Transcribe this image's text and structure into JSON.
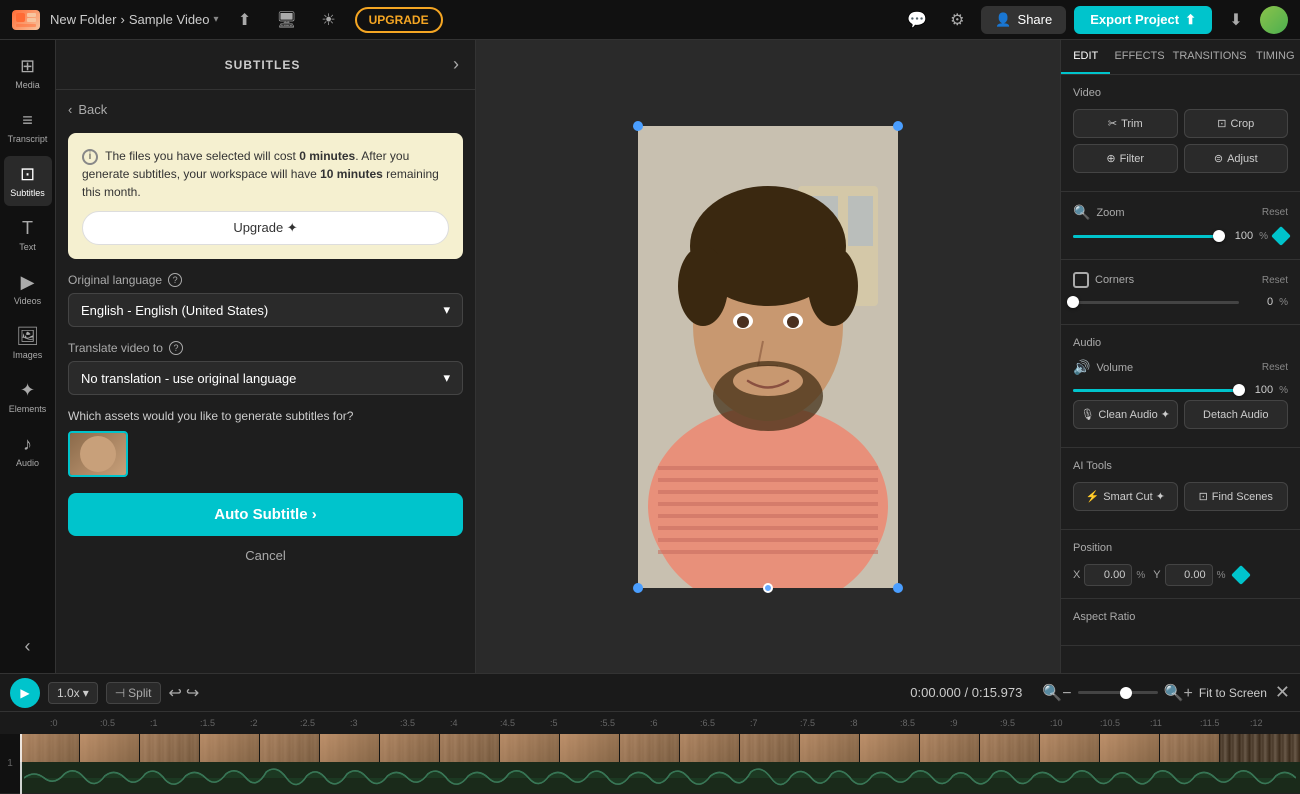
{
  "topbar": {
    "logo_text": "C",
    "folder": "New Folder",
    "separator": "›",
    "file_name": "Sample Video",
    "chevron": "▾",
    "upgrade_label": "UPGRADE",
    "share_label": "Share",
    "export_label": "Export Project",
    "settings_icon": "⚙",
    "comment_icon": "💬",
    "sun_icon": "☀",
    "upload_icon": "⬆",
    "monitor_icon": "🖥",
    "download_icon": "⬇"
  },
  "sidebar": {
    "items": [
      {
        "id": "media",
        "icon": "⊞",
        "label": "Media"
      },
      {
        "id": "transcript",
        "icon": "≡",
        "label": "Transcript"
      },
      {
        "id": "subtitles",
        "icon": "⊡",
        "label": "Subtitles",
        "active": true
      },
      {
        "id": "text",
        "icon": "T",
        "label": "Text"
      },
      {
        "id": "videos",
        "icon": "▶",
        "label": "Videos"
      },
      {
        "id": "images",
        "icon": "🖼",
        "label": "Images"
      },
      {
        "id": "elements",
        "icon": "✦",
        "label": "Elements"
      },
      {
        "id": "audio",
        "icon": "♪",
        "label": "Audio"
      }
    ]
  },
  "subtitles_panel": {
    "title": "SUBTITLES",
    "back_label": "Back",
    "info_text_1": "The files you have selected will cost ",
    "info_bold_1": "0 minutes",
    "info_text_2": ". After you generate subtitles, your workspace will have ",
    "info_bold_2": "10 minutes",
    "info_text_3": " remaining this month.",
    "upgrade_btn": "Upgrade ✦",
    "original_lang_label": "Original language",
    "original_lang_value": "English - English (United States)",
    "translate_label": "Translate video to",
    "translate_value": "No translation - use original language",
    "assets_label": "Which assets would you like to generate subtitles for?",
    "auto_subtitle_btn": "Auto Subtitle ›",
    "cancel_label": "Cancel"
  },
  "right_panel": {
    "tabs": [
      "EDIT",
      "EFFECTS",
      "TRANSITIONS",
      "TIMING"
    ],
    "active_tab": "EDIT",
    "video_section": "Video",
    "trim_label": "Trim",
    "crop_label": "Crop",
    "filter_label": "Filter",
    "adjust_label": "Adjust",
    "zoom_section": "Zoom",
    "zoom_reset": "Reset",
    "zoom_value": "100",
    "zoom_unit": "%",
    "zoom_percent": 100,
    "corners_section": "Corners",
    "corners_reset": "Reset",
    "corners_value": "0",
    "corners_unit": "%",
    "audio_section": "Audio",
    "volume_label": "Volume",
    "volume_reset": "Reset",
    "volume_value": "100",
    "volume_unit": "%",
    "clean_audio_label": "Clean Audio ✦",
    "detach_audio_label": "Detach Audio",
    "ai_tools_section": "AI Tools",
    "smart_cut_label": "Smart Cut ✦",
    "find_scenes_label": "Find Scenes",
    "position_section": "Position",
    "pos_x_label": "X",
    "pos_x_value": "0.00",
    "pos_y_label": "Y",
    "pos_y_value": "0.00",
    "pos_unit": "%",
    "aspect_ratio_section": "Aspect Ratio"
  },
  "timeline": {
    "play_icon": "▶",
    "speed": "1.0x",
    "split_icon": "⊣",
    "split_label": "Split",
    "undo_icon": "↩",
    "redo_icon": "↪",
    "current_time": "0:00.000",
    "total_time": "0:15.973",
    "time_separator": "/",
    "zoom_out_icon": "🔍",
    "zoom_in_icon": "🔍",
    "fit_screen_label": "Fit to Screen",
    "close_icon": "✕",
    "ruler_marks": [
      ":0",
      ":0.5",
      ":1",
      ":1.5",
      ":2",
      ":2.5",
      ":3",
      ":3.5",
      ":4",
      ":4.5",
      ":5",
      ":5.5",
      ":6",
      ":6.5",
      ":7",
      ":7.5",
      ":8",
      ":8.5",
      ":9",
      ":9.5",
      ":10",
      ":10.5",
      ":11",
      ":11.5",
      ":12"
    ],
    "track_number": "1"
  },
  "colors": {
    "accent": "#00c4cc",
    "upgrade_border": "#f5a623",
    "bg_dark": "#111111",
    "bg_medium": "#1e1e1e",
    "handle_blue": "#4a9eff"
  }
}
